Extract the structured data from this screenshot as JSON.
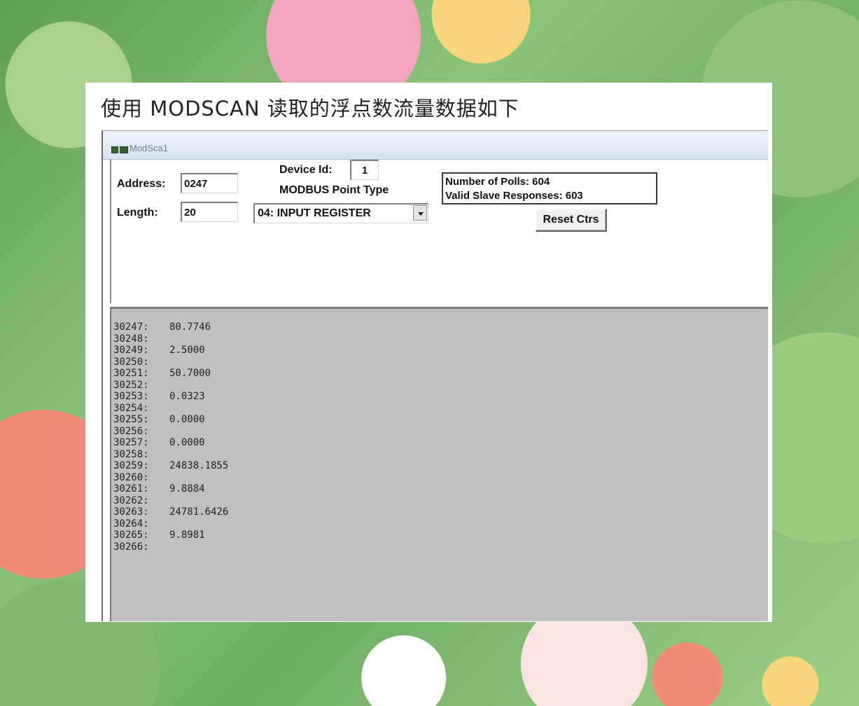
{
  "slide": {
    "title": "使用 MODSCAN 读取的浮点数流量数据如下"
  },
  "window": {
    "title": "ModSca1"
  },
  "controls": {
    "address_label": "Address:",
    "address_value": "0247",
    "length_label": "Length:",
    "length_value": "20",
    "device_id_label": "Device Id:",
    "device_id_value": "1",
    "point_type_label": "MODBUS Point Type",
    "point_type_value": "04: INPUT REGISTER",
    "polls_text": "Number of Polls: 604",
    "responses_text": "Valid Slave Responses: 603",
    "reset_label": "Reset Ctrs"
  },
  "registers": [
    {
      "addr": "30247:",
      "val": "80.7746"
    },
    {
      "addr": "30248:",
      "val": ""
    },
    {
      "addr": "30249:",
      "val": "2.5000"
    },
    {
      "addr": "30250:",
      "val": ""
    },
    {
      "addr": "30251:",
      "val": "50.7000"
    },
    {
      "addr": "30252:",
      "val": ""
    },
    {
      "addr": "30253:",
      "val": "0.0323"
    },
    {
      "addr": "30254:",
      "val": ""
    },
    {
      "addr": "30255:",
      "val": "0.0000"
    },
    {
      "addr": "30256:",
      "val": ""
    },
    {
      "addr": "30257:",
      "val": "0.0000"
    },
    {
      "addr": "30258:",
      "val": ""
    },
    {
      "addr": "30259:",
      "val": "24838.1855"
    },
    {
      "addr": "30260:",
      "val": ""
    },
    {
      "addr": "30261:",
      "val": "9.8884"
    },
    {
      "addr": "30262:",
      "val": ""
    },
    {
      "addr": "30263:",
      "val": "24781.6426"
    },
    {
      "addr": "30264:",
      "val": ""
    },
    {
      "addr": "30265:",
      "val": "9.8981"
    },
    {
      "addr": "30266:",
      "val": ""
    }
  ]
}
